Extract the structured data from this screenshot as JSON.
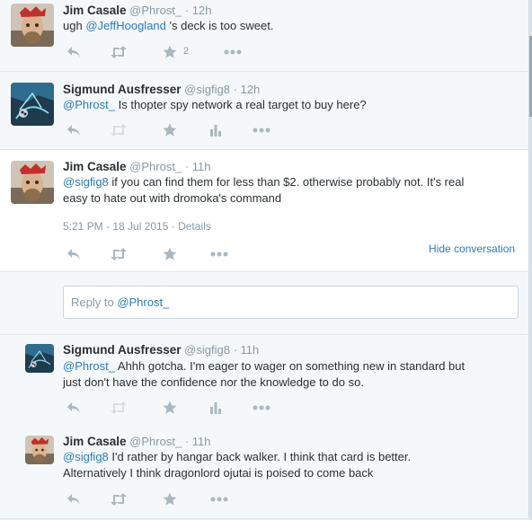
{
  "tweets": [
    {
      "name": "Jim Casale",
      "handle": "@Phrost_",
      "time": "12h",
      "text_pre": "ugh ",
      "mention": "@JeffHoogland",
      "text_post": " 's deck is too sweet.",
      "favorites": "2"
    },
    {
      "name": "Sigmund Ausfresser",
      "handle": "@sigfig8",
      "time": "12h",
      "mention": "@Phrost_",
      "text_post": " Is thopter spy network a real target to buy here?"
    },
    {
      "name": "Jim Casale",
      "handle": "@Phrost_",
      "time": "11h",
      "mention": "@sigfig8",
      "text_post_1": " if you can find them for less than $2.  otherwise probably not.  It's real",
      "text_line2": "easy to hate out with dromoka's command",
      "timestamp": "5:21 PM - 18 Jul 2015",
      "details": "Details",
      "hide_conversation": "Hide conversation"
    },
    {
      "name": "Sigmund Ausfresser",
      "handle": "@sigfig8",
      "time": "11h",
      "mention": "@Phrost_",
      "text_post_1": " Ahhh gotcha. I'm eager to wager on something new in standard but",
      "text_line2": "just don't have the confidence nor the knowledge to do so."
    },
    {
      "name": "Jim Casale",
      "handle": "@Phrost_",
      "time": "11h",
      "mention": "@sigfig8",
      "text_post_1": " I'd rather by hangar back walker.  I think that card is better.",
      "text_line2": "Alternatively I think dragonlord ojutai is poised to come back"
    }
  ],
  "reply_box": {
    "prefix": "Reply to ",
    "mention": "@Phrost_"
  },
  "separator": "·",
  "icons": [
    "reply-icon",
    "retweet-icon",
    "favorite-icon",
    "analytics-icon",
    "more-icon"
  ],
  "colors": {
    "link": "#2b7bb9",
    "muted": "#8899a6",
    "text": "#292f33",
    "background": "#f5f8fa"
  }
}
